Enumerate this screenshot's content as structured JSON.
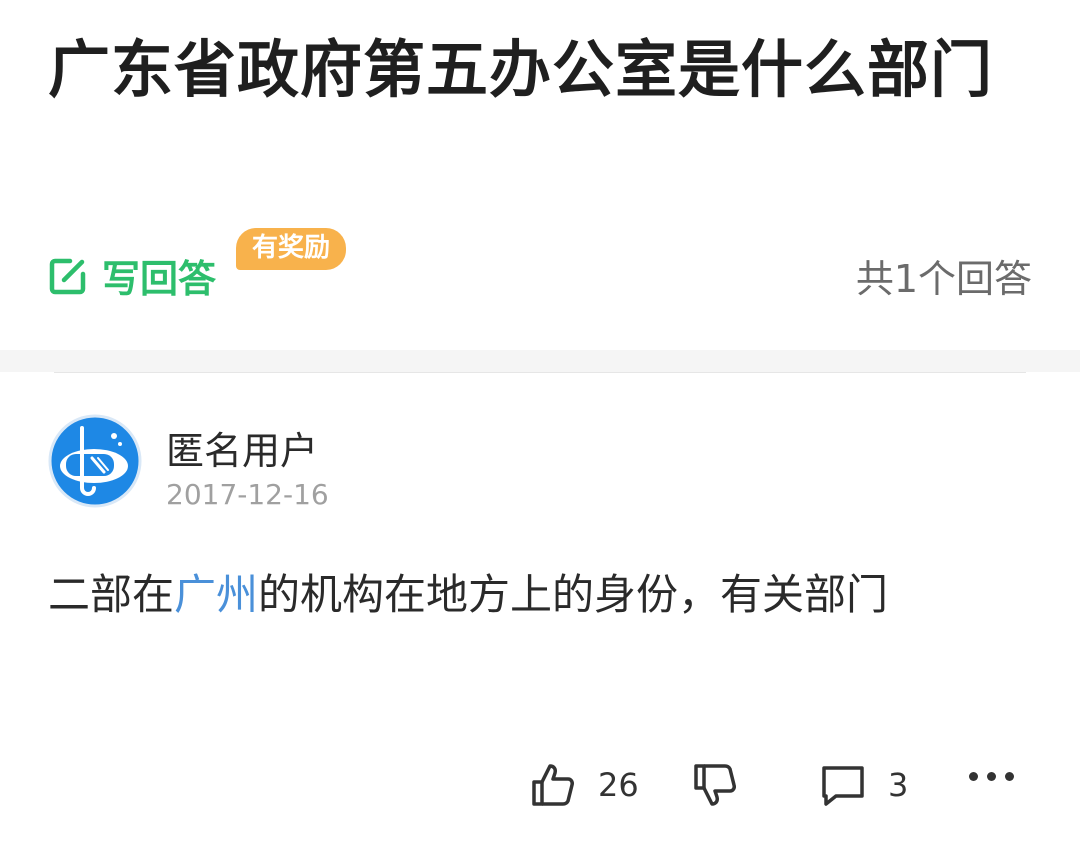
{
  "question": {
    "title": "广东省政府第五办公室是什么部门"
  },
  "answer_bar": {
    "write_label": "写回答",
    "reward_badge": "有奖励",
    "answer_count": "共1个回答"
  },
  "answer": {
    "user_name": "匿名用户",
    "date": "2017-12-16",
    "text_before": "二部在",
    "keyword": "广州",
    "text_after": "的机构在地方上的身份，有关部门",
    "likes": "26",
    "comments": "3"
  },
  "icons": {
    "write": "edit-icon",
    "avatar": "snorkel-avatar-icon",
    "like": "thumbs-up-icon",
    "dislike": "thumbs-down-icon",
    "comment": "comment-icon",
    "more": "more-dots-icon"
  },
  "colors": {
    "accent_green": "#2dbe6c",
    "reward_orange": "#f8b24c",
    "link_blue": "#4a90d9",
    "avatar_blue": "#1e88e5"
  }
}
